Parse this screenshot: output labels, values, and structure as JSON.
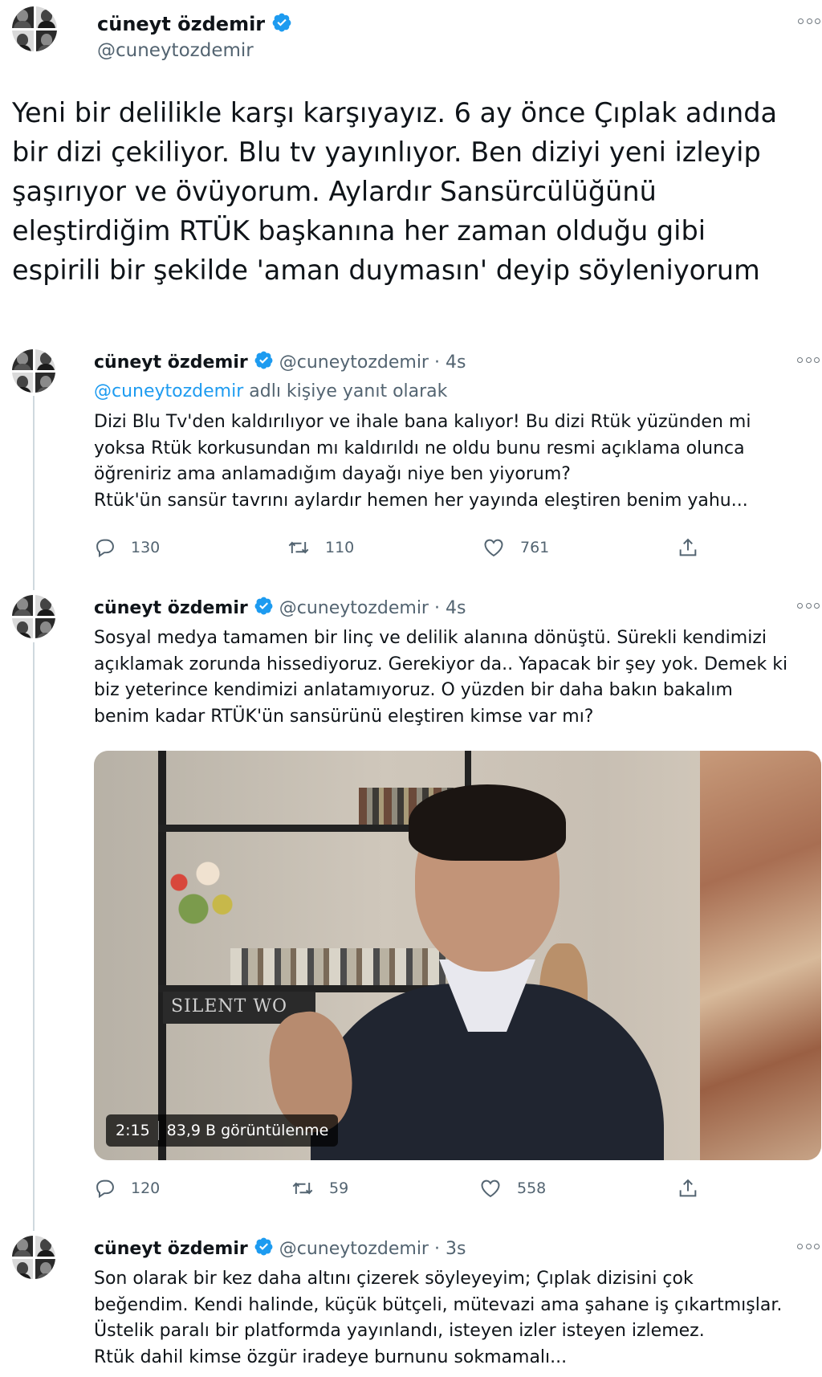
{
  "author": {
    "name": "cüneyt özdemir",
    "handle": "@cuneytozdemir"
  },
  "main_tweet": {
    "lines": [
      "Yeni bir delilikle karşı karşıyayız. 6 ay önce Çıplak adında",
      "bir dizi çekiliyor. Blu tv yayınlıyor. Ben diziyi yeni izleyip",
      "şaşırıyor ve övüyorum. Aylardır Sansürcülüğünü",
      "eleştirdiğim RTÜK başkanına her zaman olduğu gibi",
      "espirili bir şekilde 'aman duymasın' deyip söyleniyorum"
    ]
  },
  "tweets": [
    {
      "name": "cüneyt özdemir",
      "handle": "@cuneytozdemir",
      "time": "· 4s",
      "reply_to": {
        "mention": "@cuneytozdemir",
        "suffix": " adlı kişiye yanıt olarak"
      },
      "lines": [
        "Dizi Blu Tv'den kaldırılıyor ve ihale bana kalıyor! Bu dizi Rtük yüzünden mi",
        "yoksa Rtük korkusundan mı kaldırıldı ne oldu bunu resmi açıklama olunca",
        "öğreniriz ama anlamadığım dayağı niye ben yiyorum?",
        "Rtük'ün sansür tavrını aylardır hemen her yayında eleştiren benim yahu..."
      ],
      "replies": "130",
      "retweets": "110",
      "likes": "761"
    },
    {
      "name": "cüneyt özdemir",
      "handle": "@cuneytozdemir",
      "time": "· 4s",
      "lines": [
        "Sosyal medya tamamen bir linç ve delilik alanına dönüştü.  Sürekli kendimizi",
        "açıklamak zorunda hissediyoruz. Gerekiyor da.. Yapacak bir şey yok. Demek ki",
        "biz yeterince kendimizi anlatamıyoruz. O yüzden bir daha bakın bakalım",
        "benim kadar RTÜK'ün sansürünü eleştiren kimse var mı?"
      ],
      "video": {
        "duration": "2:15",
        "views": "83,9 B görüntülenme",
        "sign_text": "SILENT WO"
      },
      "replies": "120",
      "retweets": "59",
      "likes": "558"
    },
    {
      "name": "cüneyt özdemir",
      "handle": "@cuneytozdemir",
      "time": "· 3s",
      "lines": [
        "Son olarak bir kez daha altını çizerek söyleyeyim; Çıplak dizisini çok",
        "beğendim. Kendi halinde, küçük bütçeli, mütevazi ama şahane iş çıkartmışlar.",
        "Üstelik paralı bir platformda yayınlandı, isteyen izler isteyen izlemez.",
        "Rtük dahil kimse özgür iradeye burnunu sokmamalı..."
      ]
    }
  ],
  "colors": {
    "verified": "#1d9bf0",
    "text": "#0f1419",
    "meta": "#536471",
    "thread_line": "#cfd9de"
  }
}
